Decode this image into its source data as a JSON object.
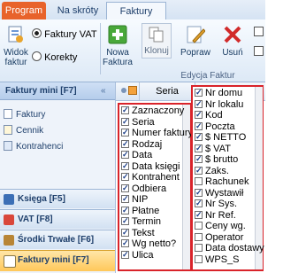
{
  "ribbon": {
    "tabs": [
      "Program",
      "Na skróty",
      "Faktury"
    ],
    "buttons": {
      "widok_faktur": "Widok\nfaktur",
      "nowa_faktura": "Nowa\nFaktura",
      "klonuj": "Klonuj",
      "popraw": "Popraw",
      "usun": "Usuń"
    },
    "view_options": {
      "faktury_vat": "Faktury VAT",
      "korekty": "Korekty",
      "selected": "Faktury VAT"
    },
    "group_label": "Edycja Faktur"
  },
  "sidebar": {
    "header": "Faktury mini [F7]",
    "links": [
      "Faktury",
      "Cennik",
      "Kontrahenci"
    ],
    "modules": [
      "Księga [F5]",
      "VAT [F8]",
      "Środki Trwałe [F6]",
      "Faktury mini [F7]"
    ],
    "active_module": "Faktury mini [F7]"
  },
  "grid": {
    "column_header": "Seria"
  },
  "columns_left": [
    {
      "label": "Zaznaczony",
      "checked": true
    },
    {
      "label": "Seria",
      "checked": true
    },
    {
      "label": "Numer faktury",
      "checked": true
    },
    {
      "label": "Rodzaj",
      "checked": true
    },
    {
      "label": "Data",
      "checked": true
    },
    {
      "label": "Data księgi",
      "checked": true
    },
    {
      "label": "Kontrahent",
      "checked": true
    },
    {
      "label": "Odbiera",
      "checked": true
    },
    {
      "label": "NIP",
      "checked": true
    },
    {
      "label": "Płatne",
      "checked": true
    },
    {
      "label": "Termin",
      "checked": true
    },
    {
      "label": "Tekst",
      "checked": true
    },
    {
      "label": "Wg netto?",
      "checked": true
    },
    {
      "label": "Ulica",
      "checked": true
    }
  ],
  "columns_right": [
    {
      "label": "Nr domu",
      "checked": true
    },
    {
      "label": "Nr lokalu",
      "checked": true
    },
    {
      "label": "Kod",
      "checked": true
    },
    {
      "label": "Poczta",
      "checked": true
    },
    {
      "label": "$ NETTO",
      "checked": true
    },
    {
      "label": "$ VAT",
      "checked": true
    },
    {
      "label": "$ brutto",
      "checked": true
    },
    {
      "label": "Zaks.",
      "checked": true
    },
    {
      "label": "Rachunek",
      "checked": false
    },
    {
      "label": "Wystawił",
      "checked": true
    },
    {
      "label": "Nr Sys.",
      "checked": true
    },
    {
      "label": "Nr Ref.",
      "checked": true
    },
    {
      "label": "Ceny wg.",
      "checked": false
    },
    {
      "label": "Operator",
      "checked": false
    },
    {
      "label": "Data dostawy",
      "checked": false
    },
    {
      "label": "WPS_S",
      "checked": false
    }
  ],
  "colors": {
    "highlight_border": "#d9232a",
    "program_tab": "#e8632b",
    "active_module": "#ffc85a"
  }
}
